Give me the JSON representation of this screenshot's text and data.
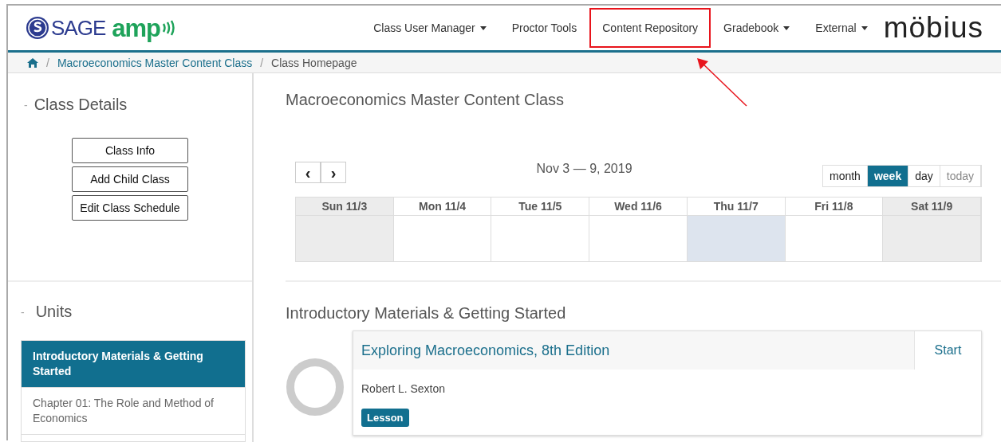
{
  "header": {
    "logo": {
      "brand": "SAGE",
      "product": "amp"
    },
    "nav": [
      {
        "label": "Class User Manager",
        "dropdown": true,
        "highlighted": false
      },
      {
        "label": "Proctor Tools",
        "dropdown": false,
        "highlighted": false
      },
      {
        "label": "Content Repository",
        "dropdown": false,
        "highlighted": true
      },
      {
        "label": "Gradebook",
        "dropdown": true,
        "highlighted": false
      },
      {
        "label": "External",
        "dropdown": true,
        "highlighted": false
      }
    ],
    "partner_logo": "möbius"
  },
  "breadcrumb": {
    "separator": "/",
    "items": [
      "Macroeconomics Master Content Class",
      "Class Homepage"
    ]
  },
  "collapse_mark": "-",
  "class_details": {
    "title": "Class Details",
    "buttons": [
      "Class Info",
      "Add Child Class",
      "Edit Class Schedule"
    ]
  },
  "units": {
    "title": "Units",
    "items": [
      {
        "label": "Introductory Materials & Getting Started",
        "selected": true
      },
      {
        "label": "Chapter 01: The Role and Method of Economics",
        "selected": false
      }
    ]
  },
  "class_title": "Macroeconomics Master Content Class",
  "calendar": {
    "prev": "‹",
    "next": "›",
    "range": "Nov 3 — 9, 2019",
    "views": [
      {
        "label": "month",
        "selected": false,
        "disabled": false
      },
      {
        "label": "week",
        "selected": true,
        "disabled": false
      },
      {
        "label": "day",
        "selected": false,
        "disabled": false
      },
      {
        "label": "today",
        "selected": false,
        "disabled": true
      }
    ],
    "days": [
      {
        "label": "Sun 11/3",
        "weekend": true,
        "today": false
      },
      {
        "label": "Mon 11/4",
        "weekend": false,
        "today": false
      },
      {
        "label": "Tue 11/5",
        "weekend": false,
        "today": false
      },
      {
        "label": "Wed 11/6",
        "weekend": false,
        "today": false
      },
      {
        "label": "Thu 11/7",
        "weekend": false,
        "today": true
      },
      {
        "label": "Fri 11/8",
        "weekend": false,
        "today": false
      },
      {
        "label": "Sat 11/9",
        "weekend": true,
        "today": false
      }
    ]
  },
  "unit_section": {
    "title": "Introductory Materials & Getting Started",
    "card": {
      "title": "Exploring Macroeconomics, 8th Edition",
      "action": "Start",
      "author": "Robert L. Sexton",
      "tag": "Lesson"
    }
  }
}
